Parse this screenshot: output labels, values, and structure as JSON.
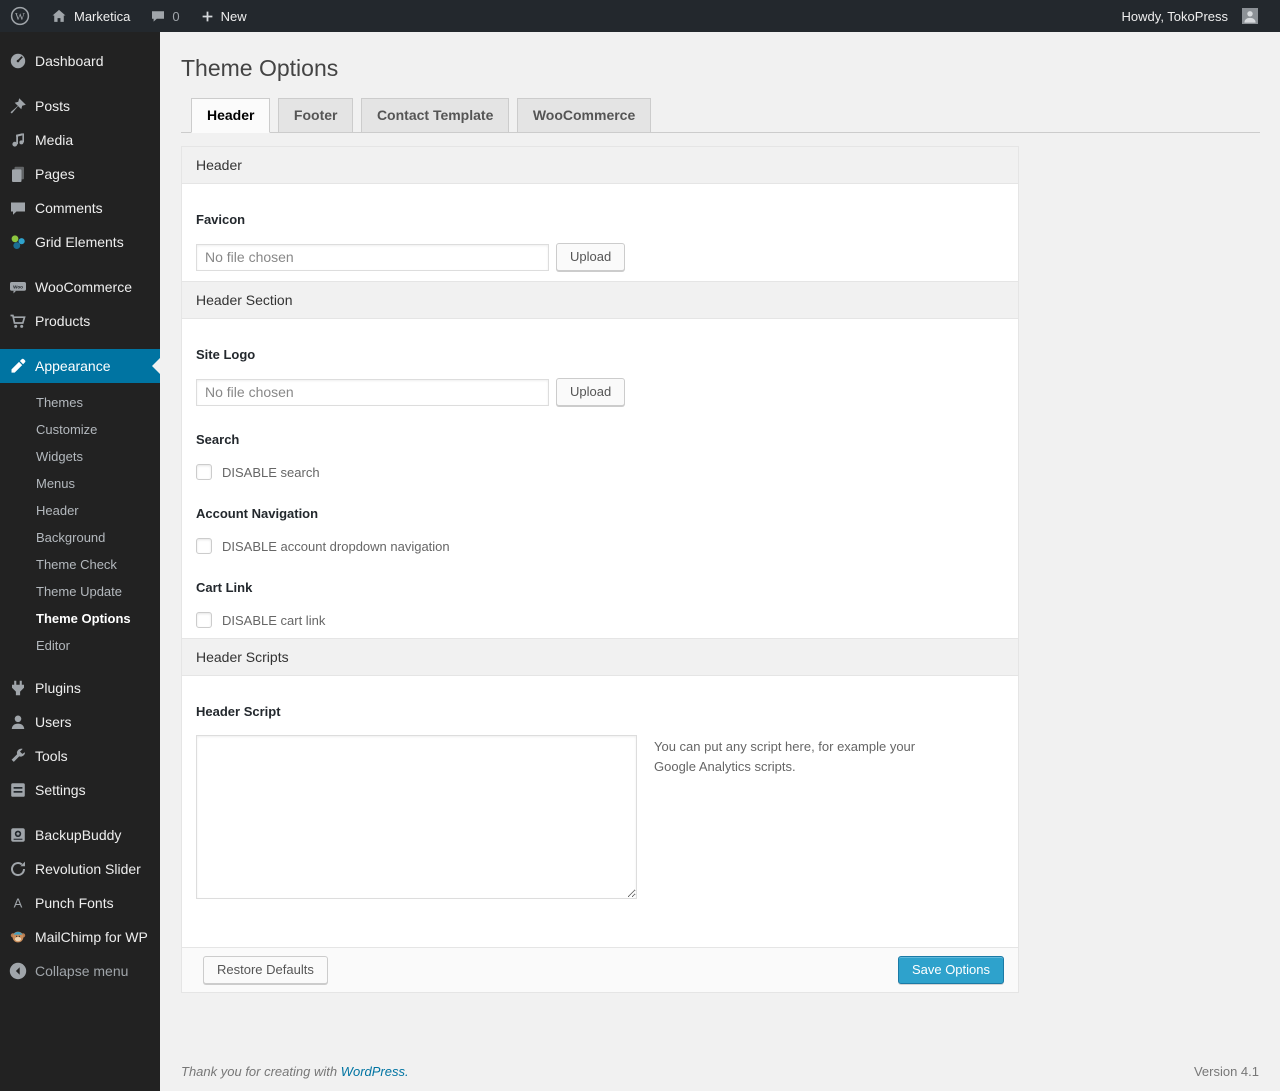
{
  "admin_bar": {
    "site_name": "Marketica",
    "comment_count": "0",
    "new_label": "New",
    "howdy_text": "Howdy, TokoPress"
  },
  "sidebar": {
    "items": [
      {
        "label": "Dashboard"
      },
      {
        "label": "Posts"
      },
      {
        "label": "Media"
      },
      {
        "label": "Pages"
      },
      {
        "label": "Comments"
      },
      {
        "label": "Grid Elements"
      },
      {
        "label": "WooCommerce"
      },
      {
        "label": "Products"
      },
      {
        "label": "Appearance"
      },
      {
        "label": "Plugins"
      },
      {
        "label": "Users"
      },
      {
        "label": "Tools"
      },
      {
        "label": "Settings"
      },
      {
        "label": "BackupBuddy"
      },
      {
        "label": "Revolution Slider"
      },
      {
        "label": "Punch Fonts"
      },
      {
        "label": "MailChimp for WP"
      }
    ],
    "appearance_submenu": [
      {
        "label": "Themes"
      },
      {
        "label": "Customize"
      },
      {
        "label": "Widgets"
      },
      {
        "label": "Menus"
      },
      {
        "label": "Header"
      },
      {
        "label": "Background"
      },
      {
        "label": "Theme Check"
      },
      {
        "label": "Theme Update"
      },
      {
        "label": "Theme Options",
        "current": true
      },
      {
        "label": "Editor"
      }
    ],
    "collapse_label": "Collapse menu"
  },
  "page": {
    "title": "Theme Options",
    "tabs": [
      {
        "label": "Header",
        "active": true
      },
      {
        "label": "Footer",
        "active": false
      },
      {
        "label": "Contact Template",
        "active": false
      },
      {
        "label": "WooCommerce",
        "active": false
      }
    ]
  },
  "panel": {
    "section_header": {
      "title": "Header"
    },
    "favicon": {
      "label": "Favicon",
      "file_value": "No file chosen",
      "upload_label": "Upload"
    },
    "section_header_section": {
      "title": "Header Section"
    },
    "site_logo": {
      "label": "Site Logo",
      "file_value": "No file chosen",
      "upload_label": "Upload"
    },
    "search": {
      "label": "Search",
      "checkbox_label": "DISABLE search",
      "checked": false
    },
    "account_navigation": {
      "label": "Account Navigation",
      "checkbox_label": "DISABLE account dropdown navigation",
      "checked": false
    },
    "cart_link": {
      "label": "Cart Link",
      "checkbox_label": "DISABLE cart link",
      "checked": false
    },
    "section_header_scripts": {
      "title": "Header Scripts"
    },
    "header_script": {
      "label": "Header Script",
      "value": "",
      "help_text": "You can put any script here, for example your Google Analytics scripts."
    },
    "restore_button": "Restore Defaults",
    "save_button": "Save Options"
  },
  "footer": {
    "thanks_text": "Thank you for creating with",
    "wordpress_link": "WordPress.",
    "version": "Version 4.1"
  },
  "colors": {
    "accent_blue": "#0074a2",
    "button_primary": "#2ea2cc",
    "admin_bar_bg": "#23282d",
    "menu_bg": "#222222",
    "page_bg": "#f1f1f1"
  }
}
